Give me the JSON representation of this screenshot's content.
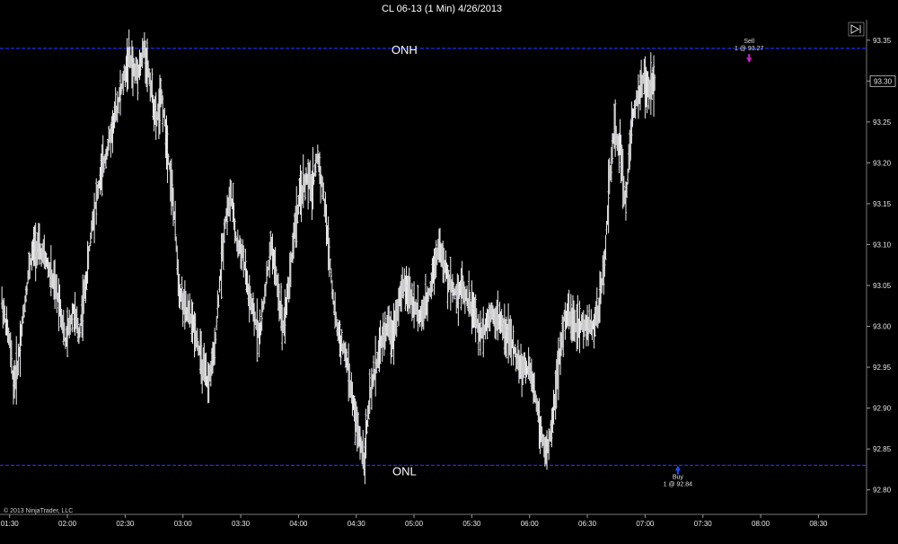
{
  "chart_data": {
    "type": "candlestick",
    "title": "CL 06-13 (1 Min)  4/26/2013",
    "copyright": "© 2013 NinjaTrader, LLC",
    "ylim": [
      92.77,
      93.375
    ],
    "y_ticks": [
      "92.80",
      "92.85",
      "92.90",
      "92.95",
      "93.00",
      "93.05",
      "93.10",
      "93.15",
      "93.20",
      "93.25",
      "93.30",
      "93.35"
    ],
    "y_tick_values": [
      92.8,
      92.85,
      92.9,
      92.95,
      93.0,
      93.05,
      93.1,
      93.15,
      93.2,
      93.25,
      93.3,
      93.35
    ],
    "x_ticks": [
      "01:30",
      "02:00",
      "02:30",
      "03:00",
      "03:30",
      "04:00",
      "04:30",
      "05:00",
      "05:30",
      "06:00",
      "06:30",
      "07:00",
      "07:30",
      "08:00",
      "08:30"
    ],
    "x_tick_minutes": [
      90,
      120,
      150,
      180,
      210,
      240,
      270,
      300,
      330,
      360,
      390,
      420,
      450,
      480,
      510
    ],
    "x_start_minute": 85,
    "x_end_minute": 535,
    "last_price": "93.30",
    "reference_lines": [
      {
        "label": "ONH",
        "value": 93.34,
        "label_minute": 295,
        "label_side": "above",
        "color": "#1c2ef0"
      },
      {
        "label": "ONL",
        "value": 92.83,
        "label_minute": 295,
        "label_side": "below",
        "color": "#1c2ef0"
      }
    ],
    "annotations": [
      {
        "kind": "sell",
        "title": "Sell",
        "detail": "1 @ 93.27",
        "minute": 474,
        "price": 93.32,
        "color": "#d01ec8"
      },
      {
        "kind": "buy",
        "title": "Buy",
        "detail": "1 @ 92.84",
        "minute": 437,
        "price": 92.83,
        "color": "#1f4fff"
      }
    ],
    "series": [
      {
        "values": [
          [
            86,
            93.03
          ],
          [
            90,
            92.98
          ],
          [
            92,
            92.93
          ],
          [
            94,
            92.95
          ],
          [
            97,
            93.01
          ],
          [
            100,
            93.07
          ],
          [
            103,
            93.1
          ],
          [
            106,
            93.09
          ],
          [
            109,
            93.08
          ],
          [
            113,
            93.05
          ],
          [
            116,
            93.03
          ],
          [
            119,
            92.98
          ],
          [
            123,
            93.02
          ],
          [
            126,
            92.99
          ],
          [
            130,
            93.06
          ],
          [
            133,
            93.13
          ],
          [
            137,
            93.18
          ],
          [
            141,
            93.22
          ],
          [
            145,
            93.26
          ],
          [
            149,
            93.3
          ],
          [
            152,
            93.33
          ],
          [
            155,
            93.31
          ],
          [
            158,
            93.32
          ],
          [
            160,
            93.34
          ],
          [
            163,
            93.3
          ],
          [
            166,
            93.25
          ],
          [
            169,
            93.28
          ],
          [
            172,
            93.22
          ],
          [
            175,
            93.15
          ],
          [
            178,
            93.05
          ],
          [
            181,
            93.02
          ],
          [
            184,
            93.01
          ],
          [
            187,
            92.99
          ],
          [
            190,
            92.95
          ],
          [
            193,
            92.93
          ],
          [
            196,
            92.96
          ],
          [
            199,
            93.05
          ],
          [
            202,
            93.13
          ],
          [
            205,
            93.16
          ],
          [
            208,
            93.1
          ],
          [
            211,
            93.09
          ],
          [
            214,
            93.04
          ],
          [
            217,
            93.01
          ],
          [
            220,
            92.99
          ],
          [
            223,
            93.05
          ],
          [
            226,
            93.1
          ],
          [
            229,
            93.05
          ],
          [
            232,
            93.0
          ],
          [
            235,
            93.05
          ],
          [
            238,
            93.12
          ],
          [
            241,
            93.16
          ],
          [
            244,
            93.18
          ],
          [
            247,
            93.17
          ],
          [
            250,
            93.21
          ],
          [
            253,
            93.16
          ],
          [
            256,
            93.09
          ],
          [
            259,
            93.01
          ],
          [
            262,
            92.98
          ],
          [
            265,
            92.96
          ],
          [
            268,
            92.91
          ],
          [
            271,
            92.87
          ],
          [
            274,
            92.84
          ],
          [
            277,
            92.91
          ],
          [
            280,
            92.95
          ],
          [
            283,
            92.98
          ],
          [
            286,
            93.0
          ],
          [
            289,
            92.99
          ],
          [
            292,
            93.03
          ],
          [
            295,
            93.05
          ],
          [
            298,
            93.04
          ],
          [
            301,
            93.02
          ],
          [
            304,
            93.01
          ],
          [
            307,
            93.03
          ],
          [
            310,
            93.07
          ],
          [
            313,
            93.1
          ],
          [
            316,
            93.07
          ],
          [
            319,
            93.05
          ],
          [
            322,
            93.04
          ],
          [
            325,
            93.05
          ],
          [
            328,
            93.03
          ],
          [
            331,
            93.02
          ],
          [
            334,
            92.99
          ],
          [
            337,
            93.0
          ],
          [
            340,
            93.02
          ],
          [
            343,
            93.01
          ],
          [
            346,
            93.0
          ],
          [
            349,
            92.99
          ],
          [
            352,
            92.97
          ],
          [
            355,
            92.95
          ],
          [
            358,
            92.95
          ],
          [
            361,
            92.94
          ],
          [
            364,
            92.9
          ],
          [
            367,
            92.86
          ],
          [
            369,
            92.84
          ],
          [
            372,
            92.89
          ],
          [
            375,
            92.95
          ],
          [
            378,
            93.01
          ],
          [
            381,
            93.01
          ],
          [
            384,
            93.0
          ],
          [
            387,
            93.0
          ],
          [
            390,
            93.0
          ],
          [
            393,
            93.0
          ],
          [
            396,
            93.02
          ],
          [
            399,
            93.08
          ],
          [
            401,
            93.16
          ],
          [
            404,
            93.24
          ],
          [
            407,
            93.22
          ],
          [
            410,
            93.15
          ],
          [
            413,
            93.25
          ],
          [
            416,
            93.28
          ],
          [
            419,
            93.3
          ],
          [
            422,
            93.29
          ],
          [
            425,
            93.3
          ]
        ]
      }
    ]
  }
}
